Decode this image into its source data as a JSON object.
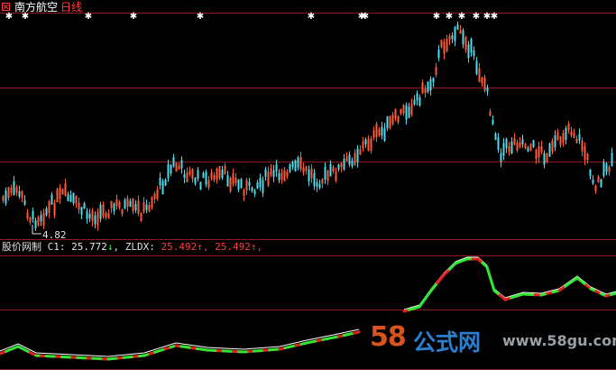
{
  "title": {
    "stock_name": "南方航空",
    "period": "日线"
  },
  "price_panel": {
    "low_label": "4.82",
    "marker_glyph": "✱"
  },
  "indicator": {
    "name": "股价网制",
    "c1_label": "C1:",
    "c1_value": "25.772",
    "c1_arrow": "↓",
    "zldx_label": ", ZLDX:",
    "zldx_value": "25.492",
    "zldx_arrow": "↑",
    "extra_value": ", 25.492",
    "extra_arrow": "↑",
    "trail": ","
  },
  "watermark": {
    "number": "58",
    "brand": "公式网",
    "url": "www.58gu.com"
  },
  "colors": {
    "background": "#000000",
    "grid": "#8b1a1a",
    "candle_up": "#ff5a3c",
    "candle_down": "#54d9e8",
    "line_green": "#33e633",
    "line_red": "#e62020",
    "line_white": "#ffffff"
  }
}
